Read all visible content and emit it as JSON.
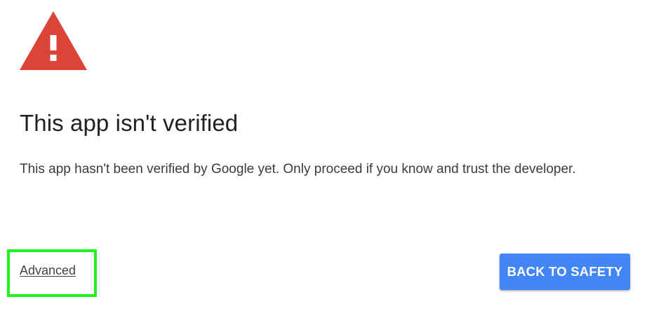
{
  "warning": {
    "icon": "warning-triangle-icon",
    "color": "#db4437"
  },
  "title": "This app isn't verified",
  "message": "This app hasn't been verified by Google yet. Only proceed if you know and trust the developer.",
  "advanced_link": "Advanced",
  "back_button": {
    "label": "BACK TO SAFETY",
    "color": "#4285f4"
  },
  "highlight_color": "#21f21c"
}
